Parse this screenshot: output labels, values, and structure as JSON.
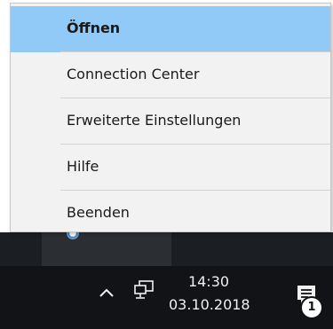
{
  "context_menu": {
    "items": [
      {
        "label": "Öffnen",
        "default": true,
        "highlighted": true
      },
      {
        "label": "Connection Center"
      },
      {
        "label": "Erweiterte Einstellungen"
      },
      {
        "label": "Hilfe"
      },
      {
        "label": "Beenden"
      }
    ]
  },
  "taskbar": {
    "clock": {
      "time": "14:30",
      "date": "03.10.2018"
    },
    "action_center": {
      "icon": "notification-icon",
      "badge_count": "1"
    },
    "tray_icons": [
      "chevron-up-icon",
      "network-icon",
      "citrix-receiver-icon"
    ]
  },
  "colors": {
    "menu_background": "#f2f2f2",
    "menu_highlight": "#91c9f7",
    "taskbar": "#111317",
    "text_light": "#f0f0f0"
  }
}
